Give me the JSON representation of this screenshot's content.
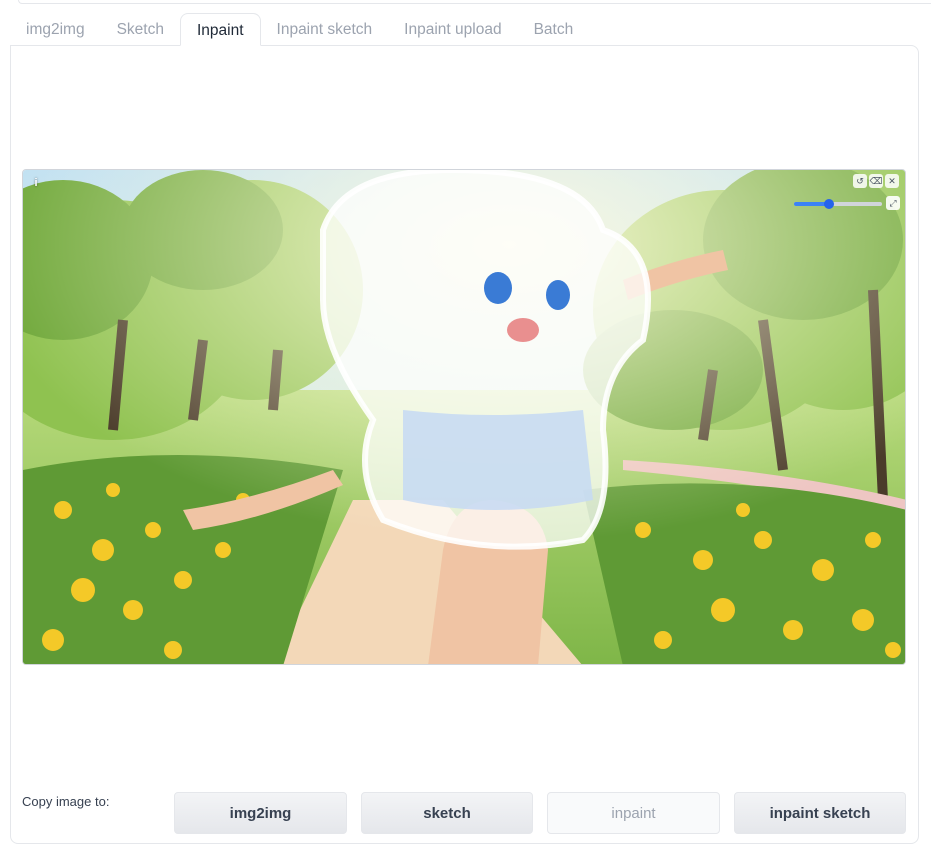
{
  "tabs": [
    {
      "label": "img2img",
      "active": false
    },
    {
      "label": "Sketch",
      "active": false
    },
    {
      "label": "Inpaint",
      "active": true
    },
    {
      "label": "Inpaint sketch",
      "active": false
    },
    {
      "label": "Inpaint upload",
      "active": false
    },
    {
      "label": "Batch",
      "active": false
    }
  ],
  "canvas": {
    "info_icon": "info-icon",
    "tools": [
      "undo-icon",
      "clear-icon",
      "close-icon"
    ],
    "brush_size_fraction": 0.4,
    "expand_icon": "resize-icon"
  },
  "copy": {
    "label": "Copy image to:",
    "buttons": [
      {
        "label": "img2img",
        "disabled": false
      },
      {
        "label": "sketch",
        "disabled": false
      },
      {
        "label": "inpaint",
        "disabled": true
      },
      {
        "label": "inpaint sketch",
        "disabled": false
      }
    ]
  },
  "colors": {
    "accent": "#2563eb",
    "sky": "#cfe6f5",
    "grass": "#9cc95a",
    "foliage": "#6fa83a",
    "flowers": "#f4c928",
    "path": "#f3d8b8",
    "mask": "#ffffff"
  }
}
